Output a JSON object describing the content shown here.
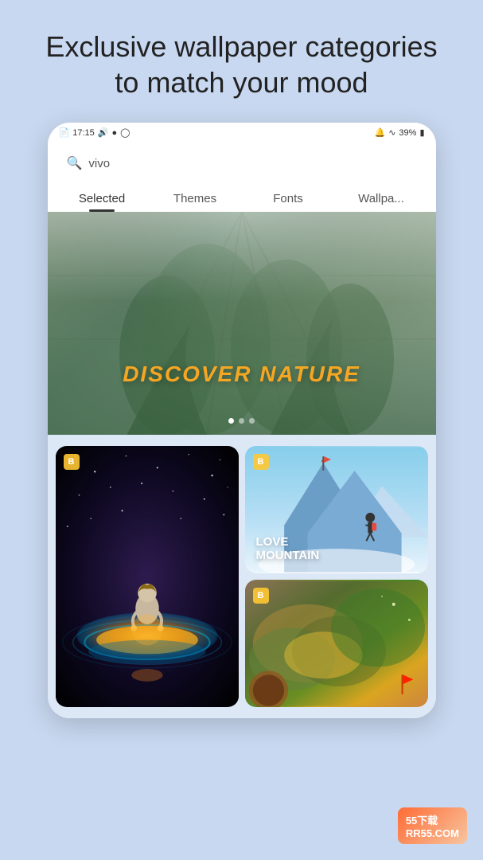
{
  "headline": {
    "line1": "Exclusive wallpaper",
    "line2": "categories to match your",
    "line3": "mood",
    "full": "Exclusive wallpaper categories to match your mood"
  },
  "status_bar": {
    "time": "17:15",
    "battery": "39%",
    "signal_icons": "🔔 ✈ 📶"
  },
  "search": {
    "placeholder": "vivo",
    "value": "vivo"
  },
  "tabs": [
    {
      "label": "Selected",
      "active": true
    },
    {
      "label": "Themes",
      "active": false
    },
    {
      "label": "Fonts",
      "active": false
    },
    {
      "label": "Wallpa...",
      "active": false
    }
  ],
  "hero": {
    "text": "DISCOVER NATURE",
    "dots_count": 3,
    "active_dot": 0
  },
  "gallery": {
    "cards": [
      {
        "id": "mountain",
        "title_line1": "LOVE",
        "title_line2": "MOUNTAIN",
        "type": "mountain",
        "badge": "B"
      },
      {
        "id": "space-right",
        "type": "space",
        "badge": "B",
        "tall": true
      },
      {
        "id": "abstract",
        "type": "abstract",
        "badge": "B"
      }
    ]
  },
  "watermark": {
    "icon": "55",
    "text": "55下载\nRR55.COM"
  },
  "colors": {
    "background": "#c8d8f0",
    "tab_active_underline": "#333333",
    "hero_text": "#f5a623",
    "mountain_text": "#ffffff"
  }
}
